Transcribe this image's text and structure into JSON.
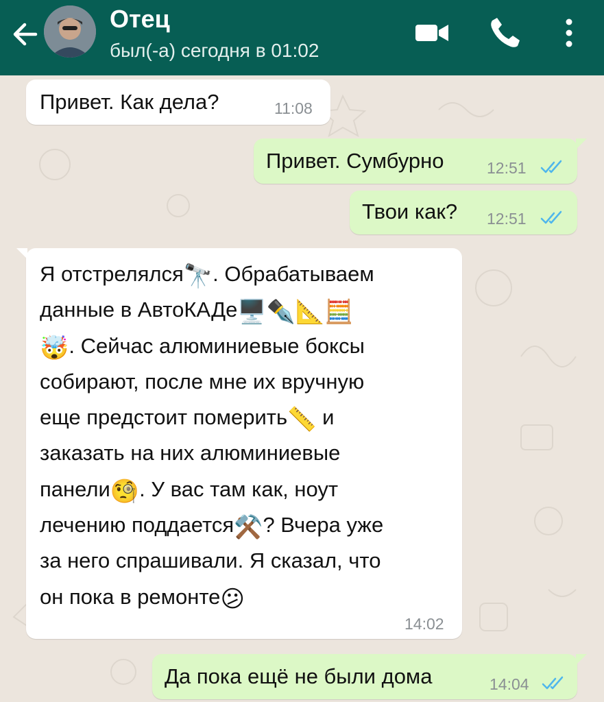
{
  "header": {
    "contact_name": "Отец",
    "status": "был(-а) сегодня в 01:02",
    "colors": {
      "bar": "#075e54"
    },
    "icons": [
      "back-arrow-icon",
      "video-call-icon",
      "phone-icon",
      "more-vert-icon"
    ]
  },
  "messages": [
    {
      "direction": "incoming",
      "text": "Привет. Как дела?",
      "time": "11:08"
    },
    {
      "direction": "outgoing",
      "text": "Привет. Сумбурно",
      "time": "12:51",
      "status": "read"
    },
    {
      "direction": "outgoing",
      "text": "Твои как?",
      "time": "12:51",
      "status": "read"
    },
    {
      "direction": "incoming",
      "time": "14:02",
      "lines": [
        [
          "Я отстрелялся",
          "🔭",
          ". Обрабатываем"
        ],
        [
          "данные в АвтоКАДе",
          "🖥️✒️📐🧮"
        ],
        [
          "🤯",
          ". Сейчас алюминиевые боксы"
        ],
        [
          "собирают, после мне их вручную"
        ],
        [
          "еще предстоит померить",
          "📏",
          " и"
        ],
        [
          "заказать на них алюминиевые"
        ],
        [
          "панели",
          "🧐",
          ". У вас там как, ноут"
        ],
        [
          "лечению поддается",
          "⚒️",
          "? Вчера уже"
        ],
        [
          "за него спрашивали. Я сказал, что"
        ],
        [
          "он пока в ремонте",
          "😕"
        ]
      ]
    },
    {
      "direction": "outgoing",
      "text": "Да пока ещё не были дома",
      "time": "14:04",
      "status": "read"
    }
  ],
  "colors": {
    "background": "#ece5dd",
    "incoming_bubble": "#ffffff",
    "outgoing_bubble": "#dcf8c6",
    "read_ticks": "#4fb6ec"
  }
}
